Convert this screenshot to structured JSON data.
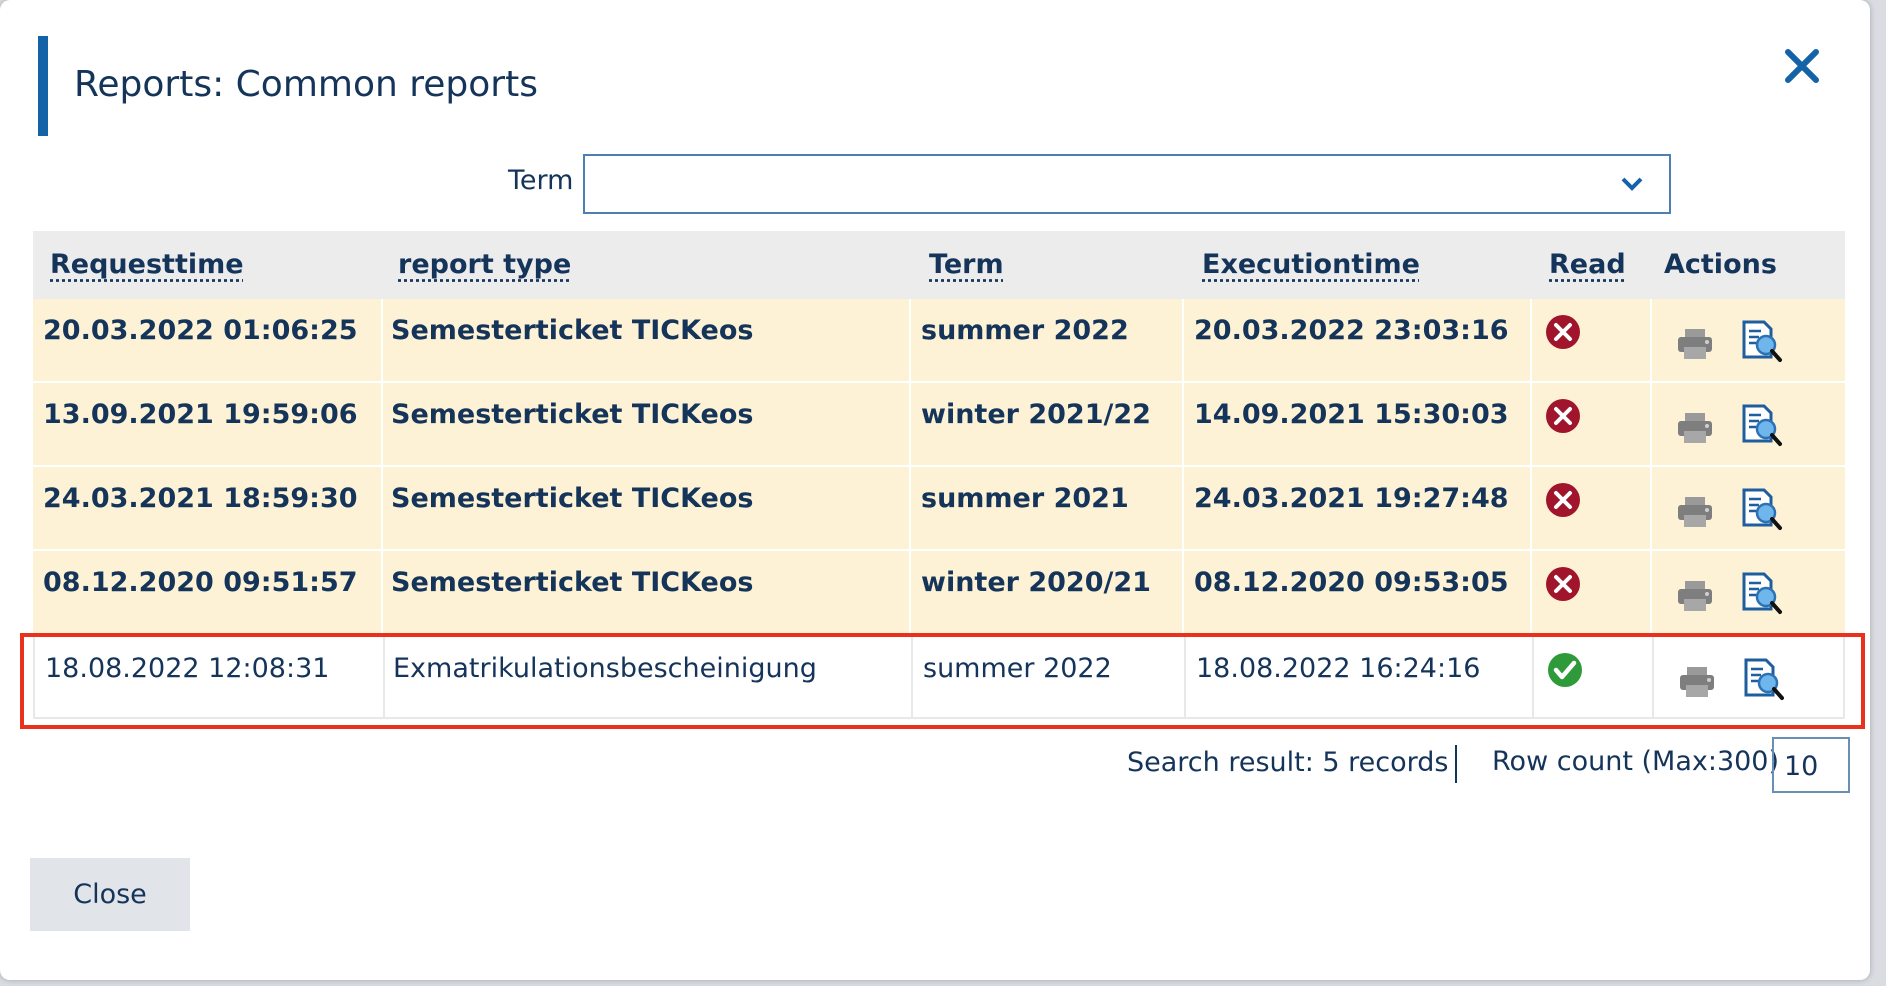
{
  "dialog": {
    "title": "Reports: Common reports",
    "close_icon": "close-x-icon"
  },
  "filter": {
    "term_label": "Term",
    "term_value": ""
  },
  "table": {
    "headers": {
      "requesttime": "Requesttime",
      "report_type": "report type",
      "term": "Term",
      "executiontime": "Executiontime",
      "read": "Read",
      "actions": "Actions"
    },
    "rows": [
      {
        "requesttime": "20.03.2022 01:06:25",
        "report_type": "Semesterticket TICKeos",
        "term": "summer 2022",
        "executiontime": "20.03.2022 23:03:16",
        "read": false
      },
      {
        "requesttime": "13.09.2021 19:59:06",
        "report_type": "Semesterticket TICKeos",
        "term": "winter 2021/22",
        "executiontime": "14.09.2021 15:30:03",
        "read": false
      },
      {
        "requesttime": "24.03.2021 18:59:30",
        "report_type": "Semesterticket TICKeos",
        "term": "summer 2021",
        "executiontime": "24.03.2021 19:27:48",
        "read": false
      },
      {
        "requesttime": "08.12.2020 09:51:57",
        "report_type": "Semesterticket TICKeos",
        "term": "winter 2020/21",
        "executiontime": "08.12.2020 09:53:05",
        "read": false
      },
      {
        "requesttime": "18.08.2022 12:08:31",
        "report_type": "Exmatrikulationsbescheinigung",
        "term": "summer 2022",
        "executiontime": "18.08.2022 16:24:16",
        "read": true
      }
    ],
    "icons": {
      "unread": "red-x-circle-icon",
      "read": "green-check-circle-icon",
      "print": "printer-icon",
      "view": "document-magnifier-icon"
    }
  },
  "footer": {
    "search_result": "Search result: 5 records",
    "row_count_label": "Row count (Max:300)",
    "row_count_value": "10",
    "close_label": "Close"
  },
  "colors": {
    "accent": "#1462a8",
    "unread_row": "#fdf2d5",
    "header_bg": "#ececec",
    "highlight": "#e8321e",
    "error_icon": "#a0152b",
    "success_icon": "#2e9a3a"
  }
}
